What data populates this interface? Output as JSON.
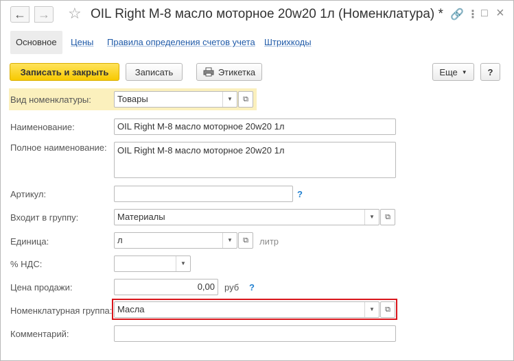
{
  "header": {
    "title": "OIL Right М-8 масло моторное 20w20 1л (Номенклатура) *",
    "back_icon": "←",
    "forward_icon": "→",
    "star_icon": "☆",
    "link_icon": "🔗",
    "menu_icon": "⋮",
    "maximize_icon": "□",
    "close_icon": "×"
  },
  "tabs": [
    {
      "label": "Основное"
    },
    {
      "label": "Цены"
    },
    {
      "label": "Правила определения счетов учета"
    },
    {
      "label": "Штрихкоды"
    }
  ],
  "toolbar": {
    "save_close_label": "Записать и закрыть",
    "save_label": "Записать",
    "label_label": "Этикетка",
    "more_label": "Еще",
    "help_label": "?"
  },
  "form": {
    "kind": {
      "label": "Вид номенклатуры:",
      "value": "Товары"
    },
    "name": {
      "label": "Наименование:",
      "value": "OIL Right М-8 масло моторное 20w20 1л"
    },
    "full_name": {
      "label": "Полное наименование:",
      "value": "OIL Right М-8 масло моторное 20w20 1л"
    },
    "article": {
      "label": "Артикул:",
      "value": "",
      "hint": "?"
    },
    "group": {
      "label": "Входит в группу:",
      "value": "Материалы"
    },
    "unit": {
      "label": "Единица:",
      "value": "л",
      "unit_text": "литр"
    },
    "vat": {
      "label": "% НДС:",
      "value": ""
    },
    "price": {
      "label": "Цена продажи:",
      "value": "0,00",
      "currency": "руб",
      "hint": "?"
    },
    "nomen_group": {
      "label": "Номенклатурная группа:",
      "value": "Масла"
    },
    "comment": {
      "label": "Комментарий:",
      "value": ""
    }
  },
  "colors": {
    "primary_button": "#f7c900",
    "highlight_row": "#fbf0bd",
    "red_frame": "#d9151b",
    "link": "#1f5aa8"
  }
}
